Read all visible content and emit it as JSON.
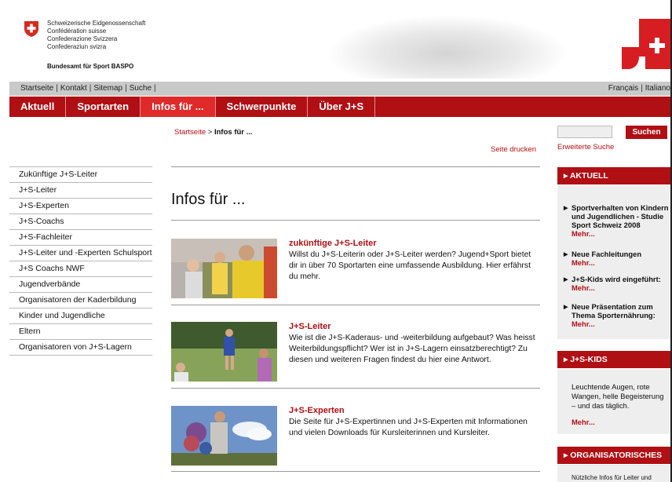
{
  "header": {
    "confederation_lines": [
      "Schweizerische Eidgenossenschaft",
      "Confédération suisse",
      "Confederazione Svizzera",
      "Confederaziun svizra"
    ],
    "office_name": "Bundesamt für Sport BASPO"
  },
  "service_nav": {
    "left": [
      "Startseite",
      "Kontakt",
      "Sitemap",
      "Suche"
    ],
    "right": [
      "Français",
      "Italiano"
    ]
  },
  "main_nav": [
    {
      "label": "Aktuell",
      "active": false
    },
    {
      "label": "Sportarten",
      "active": false
    },
    {
      "label": "Infos für ...",
      "active": true
    },
    {
      "label": "Schwerpunkte",
      "active": false
    },
    {
      "label": "Über J+S",
      "active": false
    }
  ],
  "sidebar": {
    "items": [
      "Zukünftige J+S-Leiter",
      "J+S-Leiter",
      "J+S-Experten",
      "J+S-Coachs",
      "J+S-Fachleiter",
      "J+S-Leiter und -Experten Schulsport",
      "J+S Coachs NWF",
      "Jugendverbände",
      "Organisatoren der Kaderbildung",
      "Kinder und Jugendliche",
      "Eltern",
      "Organisatoren von J+S-Lagern"
    ]
  },
  "breadcrumb": {
    "home": "Startseite",
    "separator": ">",
    "current": "Infos für ..."
  },
  "print_label": "Seite drucken",
  "page_title": "Infos für ...",
  "teasers": [
    {
      "title": "zukünftige J+S-Leiter",
      "text": "Willst du J+S-Leiterin oder J+S-Leiter werden? Jugend+Sport bietet dir in über 70 Sportarten eine umfassende Ausbildung. Hier erfährst du mehr."
    },
    {
      "title": "J+S-Leiter",
      "text": "Wie ist die J+S-Kaderaus- und -weiterbildung aufgebaut? Was heisst Weiterbildungspflicht? Wer ist in J+S-Lagern einsatzberechtigt? Zu diesen und weiteren Fragen findest du hier eine Antwort."
    },
    {
      "title": "J+S-Experten",
      "text": "Die Seite für J+S-Expertinnen und J+S-Experten mit Informationen und vielen Downloads für Kursleiterinnen und Kursleiter."
    }
  ],
  "search": {
    "button_label": "Suchen",
    "advanced_label": "Erweiterte Suche"
  },
  "aktuell": {
    "heading": "AKTUELL",
    "items": [
      {
        "text": "Sportverhalten von Kindern und Jugendlichen - Studie Sport Schweiz 2008",
        "more": "Mehr..."
      },
      {
        "text": "Neue Fachleitungen",
        "more": "Mehr..."
      },
      {
        "text": "J+S-Kids wird eingeführt:",
        "more": "Mehr..."
      },
      {
        "text": "Neue Präsentation zum Thema Sporternährung:",
        "more": "Mehr..."
      }
    ]
  },
  "kids": {
    "heading": "J+S-KIDS",
    "text": "Leuchtende Augen, rote Wangen, helle Begeisterung – und das täglich.",
    "more": "Mehr..."
  },
  "organisatorisches": {
    "heading": "ORGANISATORISCHES",
    "text": "Nützliche Infos für Leiter und"
  },
  "colors": {
    "brand_red": "#b00f14",
    "active_tab": "#e02a2a",
    "service_bar": "#c9c9c9",
    "box_bg": "#eeeeee"
  }
}
